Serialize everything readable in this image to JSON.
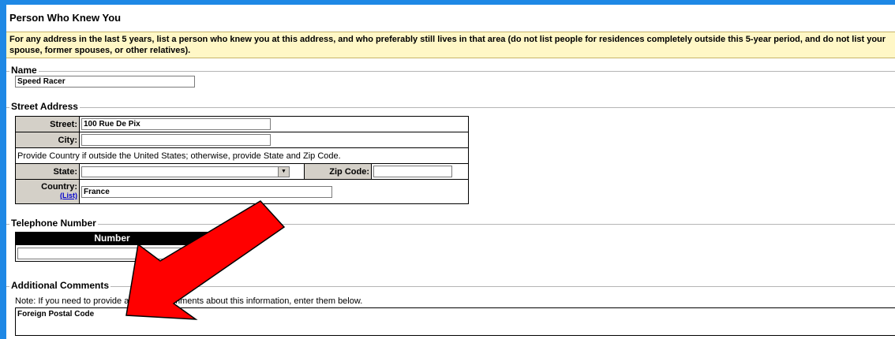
{
  "page": {
    "section_title": "Person Who Knew You",
    "instructions": "For any address in the last 5 years, list a person who knew you at this address, and who preferably still lives in that area (do not list people for residences completely outside this 5-year period, and do not list your spouse, former spouses, or other relatives)."
  },
  "name_section": {
    "legend": "Name",
    "value": "Speed Racer"
  },
  "address_section": {
    "legend": "Street Address",
    "street_label": "Street:",
    "street_value": "100 Rue De Pix",
    "city_label": "City:",
    "city_value": "",
    "country_note": "Provide Country if outside the United States; otherwise, provide State and Zip Code.",
    "state_label": "State:",
    "state_value": "",
    "zip_label": "Zip Code:",
    "zip_value": "",
    "country_label": "Country:",
    "country_link": "(List)",
    "country_value": "France"
  },
  "phone_section": {
    "legend": "Telephone Number",
    "column_header": "Number",
    "value": ""
  },
  "comments_section": {
    "legend": "Additional Comments",
    "note": "Note: If you need to provide additional comments about this information, enter them below.",
    "value": "Foreign Postal Code"
  },
  "colors": {
    "frame": "#1e88e5",
    "instructions_bg": "#fff7c6",
    "label_bg": "#d4d0c8",
    "arrow": "#ff0000"
  },
  "icons": {
    "select_arrow": "chevron-down-icon",
    "annotation": "red-arrow-overlay"
  }
}
